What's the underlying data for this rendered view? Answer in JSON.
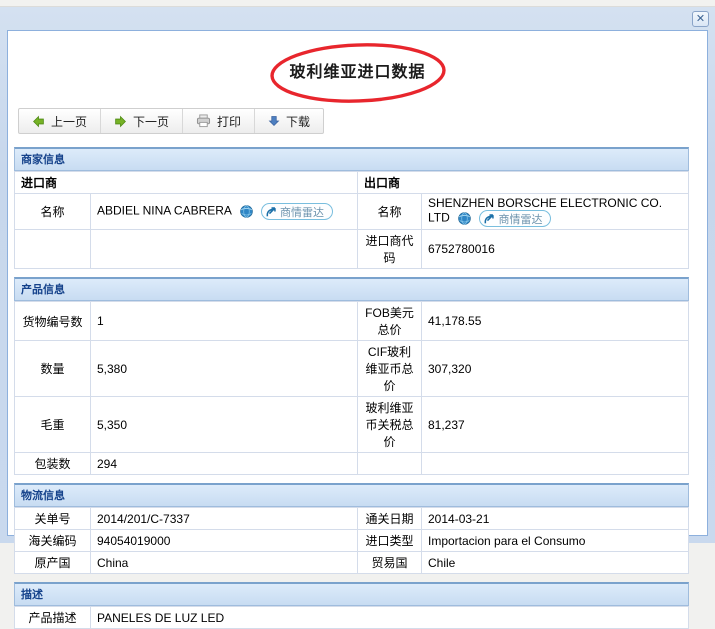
{
  "window": {
    "close_glyph": "✕"
  },
  "title": {
    "text": "玻利维亚进口数据"
  },
  "toolbar": {
    "prev": "上一页",
    "next": "下一页",
    "print": "打印",
    "download": "下载"
  },
  "badge": {
    "label": "商情雷达"
  },
  "merchant": {
    "header": "商家信息",
    "importer_group": "进口商",
    "exporter_group": "出口商",
    "name_label": "名称",
    "importer_name": "ABDIEL NINA CABRERA",
    "exporter_name": "SHENZHEN BORSCHE ELECTRONIC CO. LTD",
    "importer_code_label": "进口商代码",
    "importer_code": "6752780016"
  },
  "product": {
    "header": "产品信息",
    "rows": [
      {
        "l1": "货物编号数",
        "v1": "1",
        "l2": "FOB美元总价",
        "v2": "41,178.55"
      },
      {
        "l1": "数量",
        "v1": "5,380",
        "l2": "CIF玻利维亚币总价",
        "v2": "307,320"
      },
      {
        "l1": "毛重",
        "v1": "5,350",
        "l2": "玻利维亚币关税总价",
        "v2": "81,237"
      },
      {
        "l1": "包装数",
        "v1": "294",
        "l2": "",
        "v2": ""
      }
    ]
  },
  "logistics": {
    "header": "物流信息",
    "rows": [
      {
        "l1": "关单号",
        "v1": "2014/201/C-7337",
        "l2": "通关日期",
        "v2": "2014-03-21"
      },
      {
        "l1": "海关编码",
        "v1": "94054019000",
        "l2": "进口类型",
        "v2": "Importacion para el Consumo"
      },
      {
        "l1": "原产国",
        "v1": "China",
        "l2": "贸易国",
        "v2": "Chile"
      }
    ]
  },
  "description": {
    "header": "描述",
    "label": "产品描述",
    "value": "PANELES DE LUZ LED"
  },
  "colors": {
    "section_header_text": "#15428b",
    "annotation_red": "#e8262d",
    "badge_blue": "#2f86c5",
    "chrome_blue": "#c9d9ee",
    "arrow_green": "#76b226",
    "arrow_blue": "#4d7fc0"
  }
}
